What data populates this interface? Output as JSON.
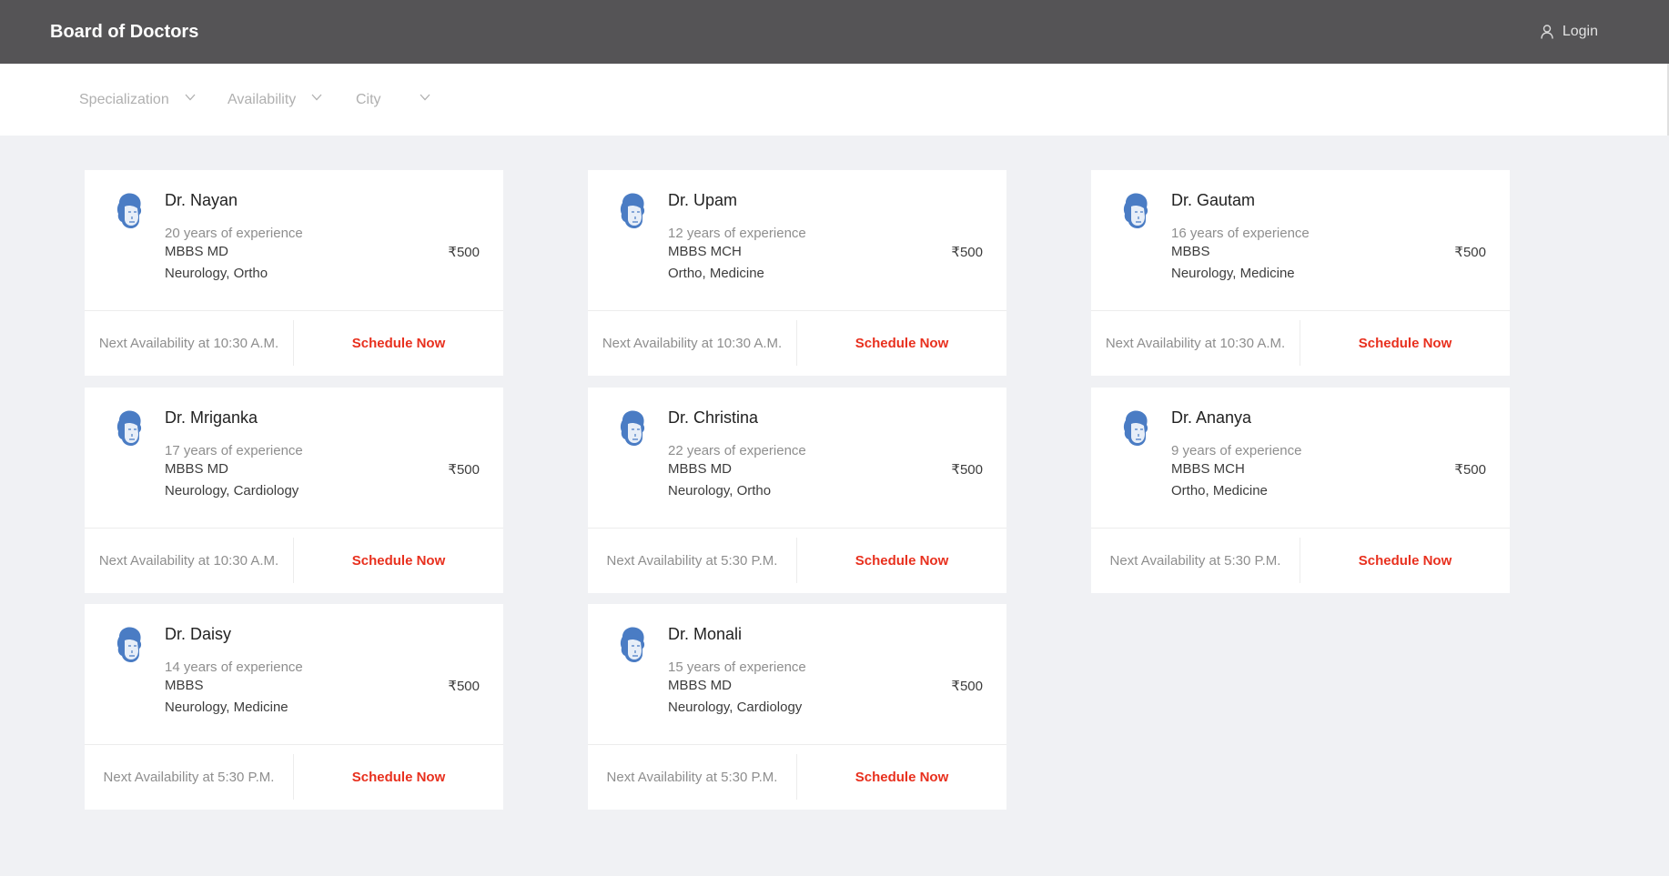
{
  "header": {
    "title": "Board of Doctors",
    "login_label": "Login"
  },
  "filters": [
    {
      "label": "Specialization"
    },
    {
      "label": "Availability"
    },
    {
      "label": "City"
    }
  ],
  "colors": {
    "header_bg": "#555456",
    "accent": "#e8301e",
    "page_bg": "#f0f1f4"
  },
  "doctors": [
    {
      "name": "Dr. Nayan",
      "experience": "20 years of experience",
      "degree": "MBBS MD",
      "specialization": "Neurology, Ortho",
      "fee": "₹500",
      "availability": "Next Availability at 10:30 A.M.",
      "action": "Schedule Now"
    },
    {
      "name": "Dr. Upam",
      "experience": "12 years of experience",
      "degree": "MBBS MCH",
      "specialization": "Ortho, Medicine",
      "fee": "₹500",
      "availability": "Next Availability at 10:30 A.M.",
      "action": "Schedule Now"
    },
    {
      "name": "Dr. Gautam",
      "experience": "16 years of experience",
      "degree": "MBBS",
      "specialization": "Neurology, Medicine",
      "fee": "₹500",
      "availability": "Next Availability at 10:30 A.M.",
      "action": "Schedule Now"
    },
    {
      "name": "Dr. Mriganka",
      "experience": "17 years of experience",
      "degree": "MBBS MD",
      "specialization": "Neurology, Cardiology",
      "fee": "₹500",
      "availability": "Next Availability at 10:30 A.M.",
      "action": "Schedule Now"
    },
    {
      "name": "Dr. Christina",
      "experience": "22 years of experience",
      "degree": "MBBS MD",
      "specialization": "Neurology, Ortho",
      "fee": "₹500",
      "availability": "Next Availability at 5:30 P.M.",
      "action": "Schedule Now"
    },
    {
      "name": "Dr. Ananya",
      "experience": "9 years of experience",
      "degree": "MBBS MCH",
      "specialization": "Ortho, Medicine",
      "fee": "₹500",
      "availability": "Next Availability at 5:30 P.M.",
      "action": "Schedule Now"
    },
    {
      "name": "Dr. Daisy",
      "experience": "14 years of experience",
      "degree": "MBBS",
      "specialization": "Neurology, Medicine",
      "fee": "₹500",
      "availability": "Next Availability at 5:30 P.M.",
      "action": "Schedule Now"
    },
    {
      "name": "Dr. Monali",
      "experience": "15 years of experience",
      "degree": "MBBS MD",
      "specialization": "Neurology, Cardiology",
      "fee": "₹500",
      "availability": "Next Availability at 5:30 P.M.",
      "action": "Schedule Now"
    }
  ]
}
